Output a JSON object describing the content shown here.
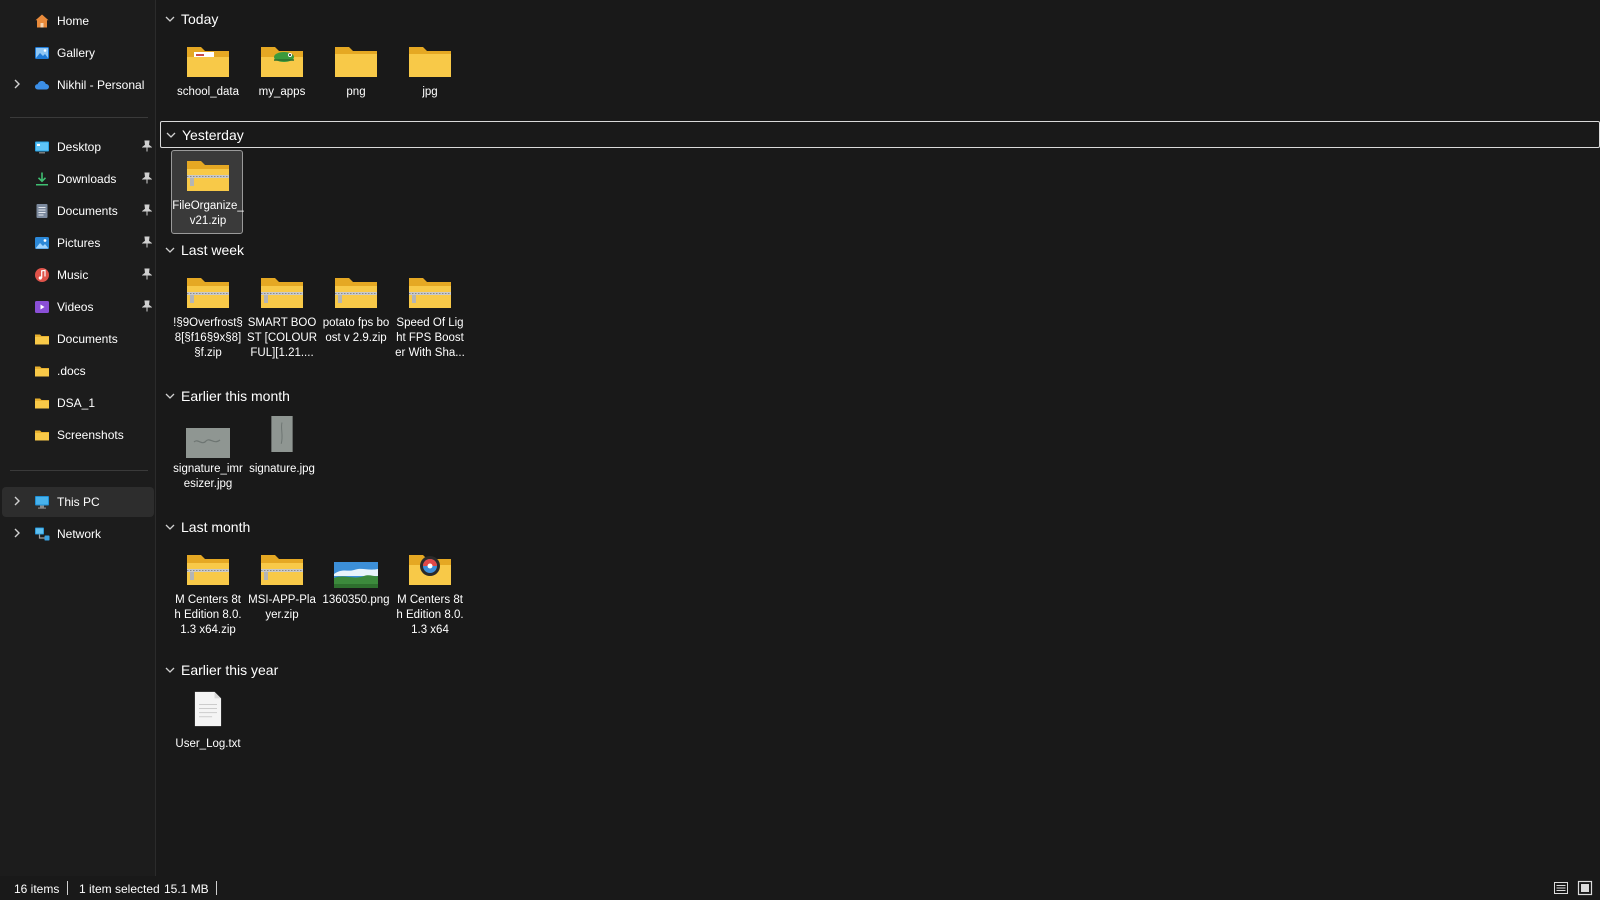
{
  "sidebar": {
    "top_items": [
      {
        "label": "Home",
        "icon": "home-icon"
      },
      {
        "label": "Gallery",
        "icon": "gallery-icon"
      },
      {
        "label": "Nikhil - Personal",
        "icon": "onedrive-cloud-icon"
      }
    ],
    "quick_access": [
      {
        "label": "Desktop",
        "icon": "desktop-icon",
        "pinned": true
      },
      {
        "label": "Downloads",
        "icon": "downloads-icon",
        "pinned": true
      },
      {
        "label": "Documents",
        "icon": "documents-icon",
        "pinned": true
      },
      {
        "label": "Pictures",
        "icon": "pictures-icon",
        "pinned": true
      },
      {
        "label": "Music",
        "icon": "music-icon",
        "pinned": true
      },
      {
        "label": "Videos",
        "icon": "videos-icon",
        "pinned": true
      },
      {
        "label": "Documents",
        "icon": "folder-icon",
        "pinned": false
      },
      {
        "label": ".docs",
        "icon": "folder-icon",
        "pinned": false
      },
      {
        "label": "DSA_1",
        "icon": "folder-icon",
        "pinned": false
      },
      {
        "label": "Screenshots",
        "icon": "folder-icon",
        "pinned": false
      }
    ],
    "bottom_items": [
      {
        "label": "This PC",
        "icon": "this-pc-icon",
        "selected": true
      },
      {
        "label": "Network",
        "icon": "network-icon",
        "selected": false
      }
    ]
  },
  "groups": [
    {
      "title": "Today",
      "items": [
        {
          "name": "school_data",
          "icon": "folder-with-file-icon"
        },
        {
          "name": "my_apps",
          "icon": "folder-with-app-icon"
        },
        {
          "name": "png",
          "icon": "folder-icon"
        },
        {
          "name": "jpg",
          "icon": "folder-icon"
        }
      ]
    },
    {
      "title": "Yesterday",
      "items": [
        {
          "name": "FileOrganize_v21.zip",
          "icon": "zip-folder-icon",
          "selected": true
        }
      ]
    },
    {
      "title": "Last week",
      "items": [
        {
          "name": "!§9Overfrost§8[§f16§9x§8]§f.zip",
          "icon": "zip-folder-icon"
        },
        {
          "name": "SMART BOOST [COLOURFUL][1.21....",
          "icon": "zip-folder-icon"
        },
        {
          "name": "potato fps boost v 2.9.zip",
          "icon": "zip-folder-icon"
        },
        {
          "name": "Speed Of Light FPS Booster With Sha...",
          "icon": "zip-folder-icon"
        }
      ]
    },
    {
      "title": "Earlier this month",
      "items": [
        {
          "name": "signature_imresizer.jpg",
          "icon": "image-thumbnail-icon"
        },
        {
          "name": "signature.jpg",
          "icon": "image-thumbnail-icon"
        }
      ]
    },
    {
      "title": "Last month",
      "items": [
        {
          "name": "M Centers 8th Edition 8.0.1.3 x64.zip",
          "icon": "zip-folder-icon"
        },
        {
          "name": "MSI-APP-Player.zip",
          "icon": "zip-folder-icon"
        },
        {
          "name": "1360350.png",
          "icon": "landscape-image-icon"
        },
        {
          "name": "M Centers 8th Edition 8.0.1.3 x64",
          "icon": "folder-with-app-icon"
        }
      ]
    },
    {
      "title": "Earlier this year",
      "items": [
        {
          "name": "User_Log.txt",
          "icon": "text-document-icon"
        }
      ]
    }
  ],
  "statusbar": {
    "item_count": "16 items",
    "selection": "1 item selected",
    "size": "15.1 MB"
  },
  "colors": {
    "background": "#191919",
    "folder": "#f8c948",
    "selection": "#3a3a3a"
  }
}
